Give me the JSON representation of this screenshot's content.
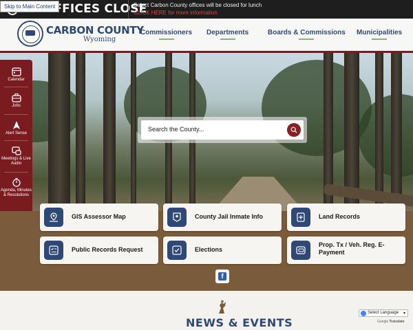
{
  "skip_link": "Skip to Main Content",
  "alert": {
    "headline": "Y OFFICES CLOSE",
    "message": "Select Carbon County offices will be closed for lunch",
    "link": "CLICK HERE for more information"
  },
  "header": {
    "title": "CARBON COUNTY",
    "subtitle": "Wyoming",
    "nav": [
      {
        "label": "Commissioners"
      },
      {
        "label": "Departments"
      },
      {
        "label": "Boards & Commissions"
      },
      {
        "label": "Municipalities"
      }
    ]
  },
  "search": {
    "placeholder": "Search the County..."
  },
  "sidebar": {
    "items": [
      {
        "label": "Calendar",
        "icon": "calendar-icon"
      },
      {
        "label": "Jobs",
        "icon": "briefcase-icon"
      },
      {
        "label": "Alert Sense",
        "icon": "alert-icon"
      },
      {
        "label": "Meetings & Live Audio",
        "icon": "meetings-icon"
      },
      {
        "label": "Agenda, Minutes & Resolutions",
        "icon": "timer-icon"
      }
    ]
  },
  "quick_links": [
    {
      "label": "GIS Assessor Map",
      "icon": "map-pin-icon"
    },
    {
      "label": "County Jail Inmate Info",
      "icon": "badge-icon"
    },
    {
      "label": "Land Records",
      "icon": "document-icon"
    },
    {
      "label": "Public Records Request",
      "icon": "checklist-icon"
    },
    {
      "label": "Elections",
      "icon": "ballot-check-icon"
    },
    {
      "label": "Prop. Tx / Veh. Reg. E-Payment",
      "icon": "payment-icon"
    }
  ],
  "social": {
    "facebook": "f"
  },
  "news": {
    "title": "NEWS & EVENTS"
  },
  "translate": {
    "label": "Select Language",
    "powered_by": "Google",
    "powered_suffix": "Translate"
  },
  "colors": {
    "brand_blue": "#2f4977",
    "brand_red": "#7a1b20",
    "brown": "#7a5c3c"
  }
}
